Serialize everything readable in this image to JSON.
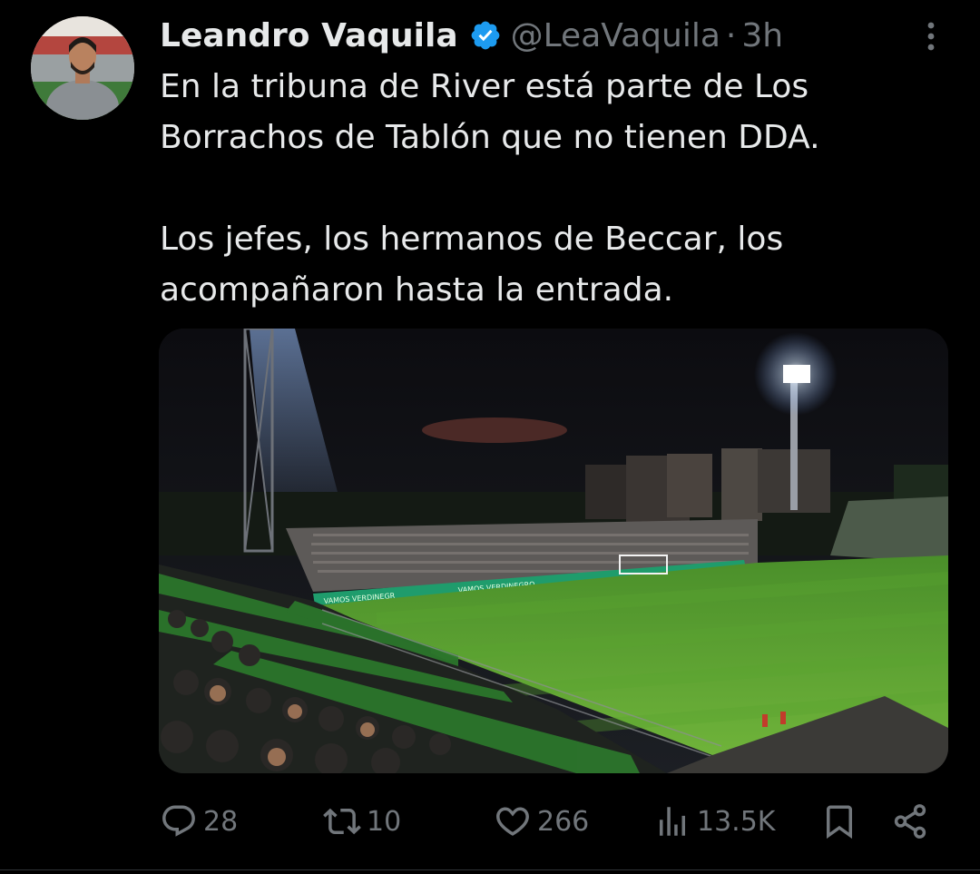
{
  "author": {
    "name": "Leandro Vaquila",
    "handle": "@LeaVaquila",
    "separator": "·",
    "time": "3h",
    "verified": true
  },
  "tweet": {
    "text": "En la tribuna de River está parte de Los Borrachos de Tablón que no tienen DDA.\n\nLos jefes, los hermanos de Beccar, los acompañaron hasta la entrada."
  },
  "actions": {
    "replies": "28",
    "retweets": "10",
    "likes": "266",
    "views": "13.5K"
  },
  "media": {
    "banner_left": "VAMOS VERDINEGR",
    "banner_mid": "VAMOS VERDINEGRO"
  },
  "colors": {
    "background": "#000000",
    "text": "#e7e9ea",
    "muted": "#71767b",
    "verified": "#1d9bf0",
    "pitch": "#4f9a2c"
  },
  "icons": [
    "verified-badge-icon",
    "more-icon",
    "reply-icon",
    "retweet-icon",
    "like-icon",
    "views-icon",
    "bookmark-icon",
    "share-icon"
  ]
}
